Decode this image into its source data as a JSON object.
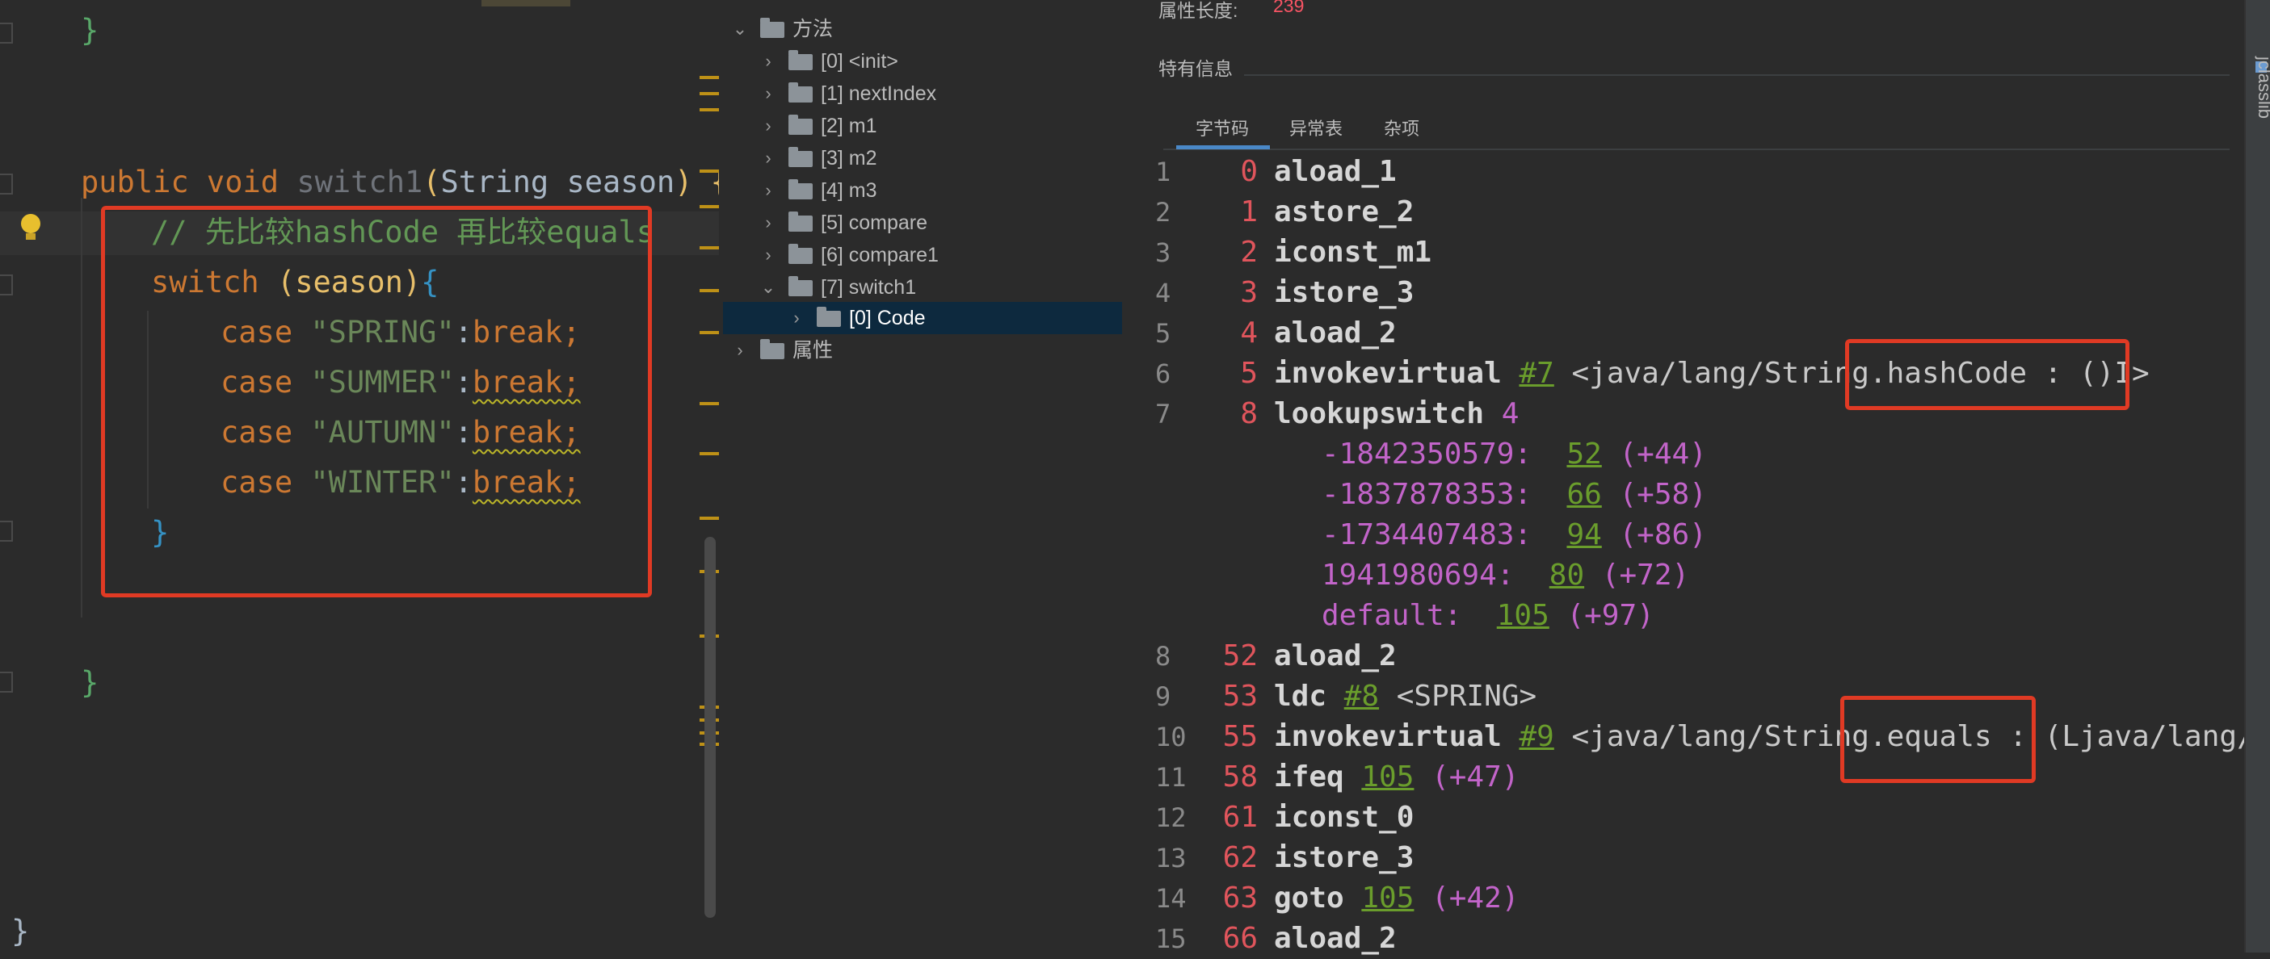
{
  "editor": {
    "lines": [
      {
        "id": "brace-close-1",
        "text": "}"
      },
      {
        "id": "method-sig",
        "keyword": "public void ",
        "name": "switch1",
        "params_open": "(",
        "param_type": "String",
        "param_name": " season",
        "params_close": ")",
        "brace": " {"
      },
      {
        "id": "comment",
        "text": "// 先比较hashCode 再比较equals"
      },
      {
        "id": "switch",
        "keyword": "switch ",
        "arg": "(season)",
        "brace": "{"
      },
      {
        "id": "case-1",
        "keyword": "case ",
        "value": "\"SPRING\"",
        "colon": ":",
        "brk": "break;"
      },
      {
        "id": "case-2",
        "keyword": "case ",
        "value": "\"SUMMER\"",
        "colon": ":",
        "brk": "break;"
      },
      {
        "id": "case-3",
        "keyword": "case ",
        "value": "\"AUTUMN\"",
        "colon": ":",
        "brk": "break;"
      },
      {
        "id": "case-4",
        "keyword": "case ",
        "value": "\"WINTER\"",
        "colon": ":",
        "brk": "break;"
      },
      {
        "id": "switch-close",
        "text": "}"
      },
      {
        "id": "method-close",
        "text": "}"
      },
      {
        "id": "class-close",
        "text": "}"
      }
    ]
  },
  "tree": {
    "items": [
      {
        "label": "方法",
        "expanded": true
      },
      {
        "label": "[0] <init>"
      },
      {
        "label": "[1] nextIndex"
      },
      {
        "label": "[2] m1"
      },
      {
        "label": "[3] m2"
      },
      {
        "label": "[4] m3"
      },
      {
        "label": "[5] compare"
      },
      {
        "label": "[6] compare1"
      },
      {
        "label": "[7] switch1",
        "expanded": true
      },
      {
        "label": "[0] Code",
        "selected": true
      },
      {
        "label": "属性"
      }
    ]
  },
  "panel": {
    "attr_label": "属性长度:",
    "attr_value": "239",
    "special_label": "特有信息",
    "tabs": [
      "字节码",
      "异常表",
      "杂项"
    ],
    "active_tab": "字节码"
  },
  "bytecode": {
    "rows": [
      {
        "ln": "1",
        "off": "0",
        "op": "aload_1"
      },
      {
        "ln": "2",
        "off": "1",
        "op": "astore_2"
      },
      {
        "ln": "3",
        "off": "2",
        "op": "iconst_m1"
      },
      {
        "ln": "4",
        "off": "3",
        "op": "istore_3"
      },
      {
        "ln": "5",
        "off": "4",
        "op": "aload_2"
      },
      {
        "ln": "6",
        "off": "5",
        "op": "invokevirtual ",
        "ref": "#7",
        "comment": " <java/lang/String.hashCode : ()I>"
      },
      {
        "ln": "7",
        "off": "8",
        "op": "lookupswitch ",
        "num": "4"
      }
    ],
    "switch_entries": [
      {
        "key": "-1842350579:  ",
        "target": "52",
        "rel": " (+44)"
      },
      {
        "key": "-1837878353:  ",
        "target": "66",
        "rel": " (+58)"
      },
      {
        "key": "-1734407483:  ",
        "target": "94",
        "rel": " (+86)"
      },
      {
        "key": "1941980694:  ",
        "target": "80",
        "rel": " (+72)"
      },
      {
        "key": "default:  ",
        "target": "105",
        "rel": " (+97)"
      }
    ],
    "rows2": [
      {
        "ln": "8",
        "off": "52",
        "op": "aload_2"
      },
      {
        "ln": "9",
        "off": "53",
        "op": "ldc ",
        "ref": "#8",
        "comment": " <SPRING>"
      },
      {
        "ln": "10",
        "off": "55",
        "op": "invokevirtual ",
        "ref": "#9",
        "comment": " <java/lang/String.equals : (Ljava/lang/O"
      },
      {
        "ln": "11",
        "off": "58",
        "op": "ifeq ",
        "ref": "105",
        "rel": " (+47)"
      },
      {
        "ln": "12",
        "off": "61",
        "op": "iconst_0"
      },
      {
        "ln": "13",
        "off": "62",
        "op": "istore_3"
      },
      {
        "ln": "14",
        "off": "63",
        "op": "goto ",
        "ref": "105",
        "rel": " (+42)"
      },
      {
        "ln": "15",
        "off": "66",
        "op": "aload_2"
      }
    ]
  },
  "right_strip": {
    "label": "jclasslib"
  },
  "colors": {
    "highlight": "#e03a24",
    "keyword": "#cc7832",
    "string": "#6a8759",
    "offset": "#e0555c",
    "ref": "#6a9d2c",
    "switch_key": "#c264c9"
  }
}
